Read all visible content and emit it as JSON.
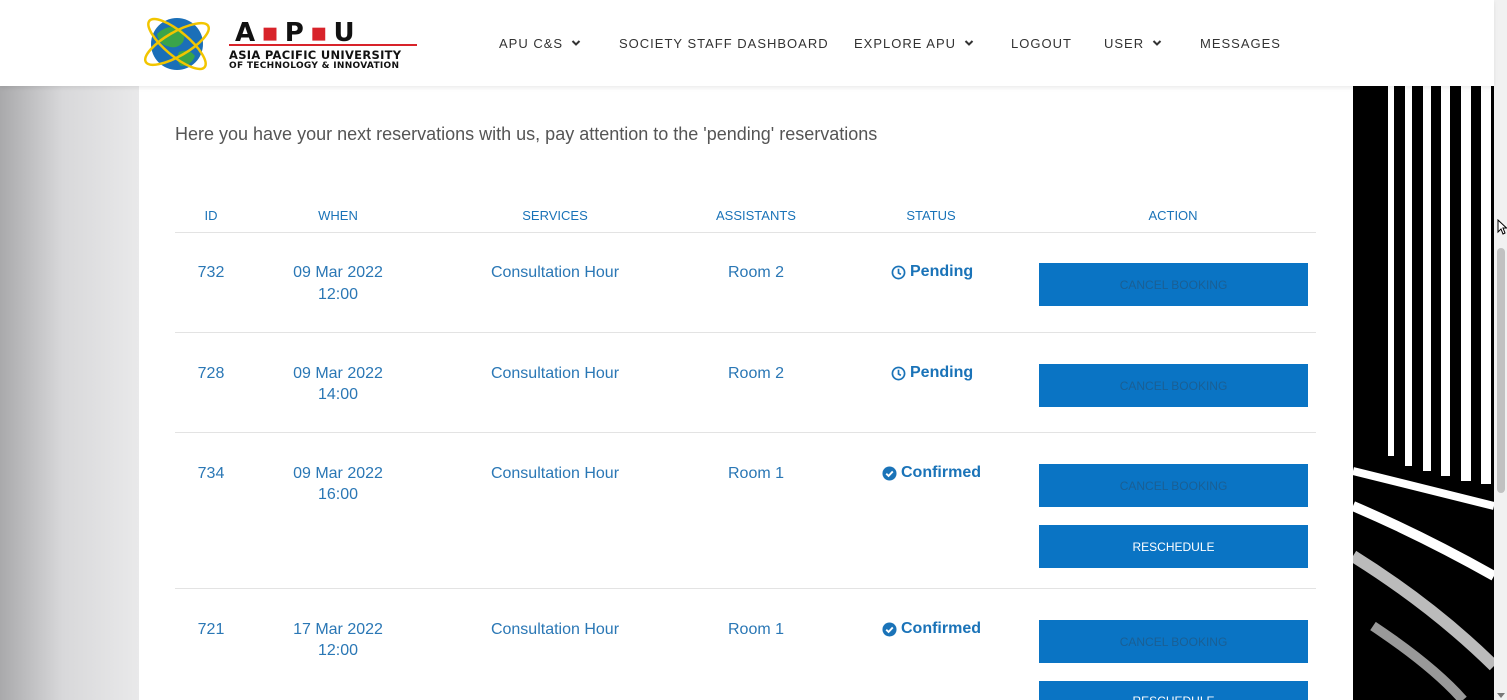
{
  "brand": {
    "letters": [
      "A",
      "P",
      "U"
    ],
    "line1": "ASIA PACIFIC UNIVERSITY",
    "line2": "OF TECHNOLOGY & INNOVATION"
  },
  "nav": [
    {
      "label": "APU C&S",
      "dropdown": true
    },
    {
      "label": "SOCIETY STAFF DASHBOARD",
      "dropdown": false
    },
    {
      "label": "EXPLORE APU",
      "dropdown": true
    },
    {
      "label": "LOGOUT",
      "dropdown": false
    },
    {
      "label": "USER",
      "dropdown": true
    },
    {
      "label": "MESSAGES",
      "dropdown": false
    }
  ],
  "intro": "Here you have your next reservations with us, pay attention to the 'pending' reservations",
  "table": {
    "headers": [
      "ID",
      "WHEN",
      "SERVICES",
      "ASSISTANTS",
      "STATUS",
      "ACTION"
    ],
    "rows": [
      {
        "id": "732",
        "date": "09 Mar 2022",
        "time": "12:00",
        "service": "Consultation Hour",
        "assistant": "Room 2",
        "status": "Pending",
        "status_icon": "clock-icon",
        "actions": [
          "CANCEL BOOKING"
        ]
      },
      {
        "id": "728",
        "date": "09 Mar 2022",
        "time": "14:00",
        "service": "Consultation Hour",
        "assistant": "Room 2",
        "status": "Pending",
        "status_icon": "clock-icon",
        "actions": [
          "CANCEL BOOKING"
        ]
      },
      {
        "id": "734",
        "date": "09 Mar 2022",
        "time": "16:00",
        "service": "Consultation Hour",
        "assistant": "Room 1",
        "status": "Confirmed",
        "status_icon": "check-circle-icon",
        "actions": [
          "CANCEL BOOKING",
          "RESCHEDULE"
        ]
      },
      {
        "id": "721",
        "date": "17 Mar 2022",
        "time": "12:00",
        "service": "Consultation Hour",
        "assistant": "Room 1",
        "status": "Confirmed",
        "status_icon": "check-circle-icon",
        "actions": [
          "CANCEL BOOKING",
          "RESCHEDULE"
        ]
      }
    ]
  },
  "colors": {
    "accent": "#1a73b8",
    "button": "#0a74c4",
    "brand_red": "#d8232a"
  }
}
